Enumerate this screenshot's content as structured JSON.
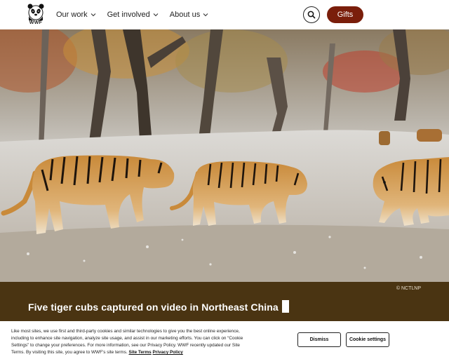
{
  "header": {
    "logo_text": "WWF",
    "nav": [
      {
        "label": "Our work"
      },
      {
        "label": "Get involved"
      },
      {
        "label": "About us"
      }
    ],
    "search_icon": "search-icon",
    "gifts_label": "Gifts",
    "accent_color": "#7a1e0b"
  },
  "hero": {
    "photo_credit": "© NCTLNP",
    "headline": "Five tiger cubs captured on video in Northeast China"
  },
  "cookie_banner": {
    "text_main": "Like most sites, we use first and third-party cookies and similar technologies to give you the best online experience, including to enhance site navigation, analyze site usage, and assist in our marketing efforts. You can click on “Cookie Settings” to change your preferences. For more information, see our Privacy Policy. WWF recently updated our Site Terms. By visiting this site, you agree to WWF’s site terms.",
    "site_terms_link": "Site Terms",
    "privacy_link": "Privacy Policy",
    "dismiss_label": "Dismiss",
    "settings_label": "Cookie settings"
  }
}
